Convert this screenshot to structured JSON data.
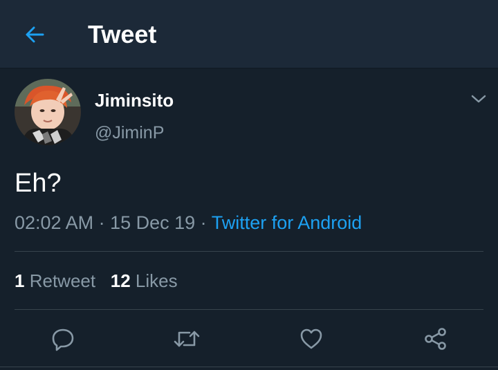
{
  "header": {
    "title": "Tweet",
    "back_icon": "arrow-left-icon"
  },
  "tweet": {
    "display_name": "Jiminsito",
    "handle": "@JiminP",
    "text": "Eh?",
    "time": "02:02 AM",
    "date": "15 Dec 19",
    "source": "Twitter for Android",
    "separator": " · "
  },
  "stats": {
    "retweets_count": "1",
    "retweets_label": "Retweet",
    "likes_count": "12",
    "likes_label": "Likes"
  },
  "actions": [
    "reply-icon",
    "retweet-icon",
    "like-icon",
    "share-icon"
  ],
  "colors": {
    "background": "#15202b",
    "header_background": "#1c2938",
    "accent": "#1da1f2",
    "secondary_text": "#8899a6",
    "divider": "#38444d"
  }
}
